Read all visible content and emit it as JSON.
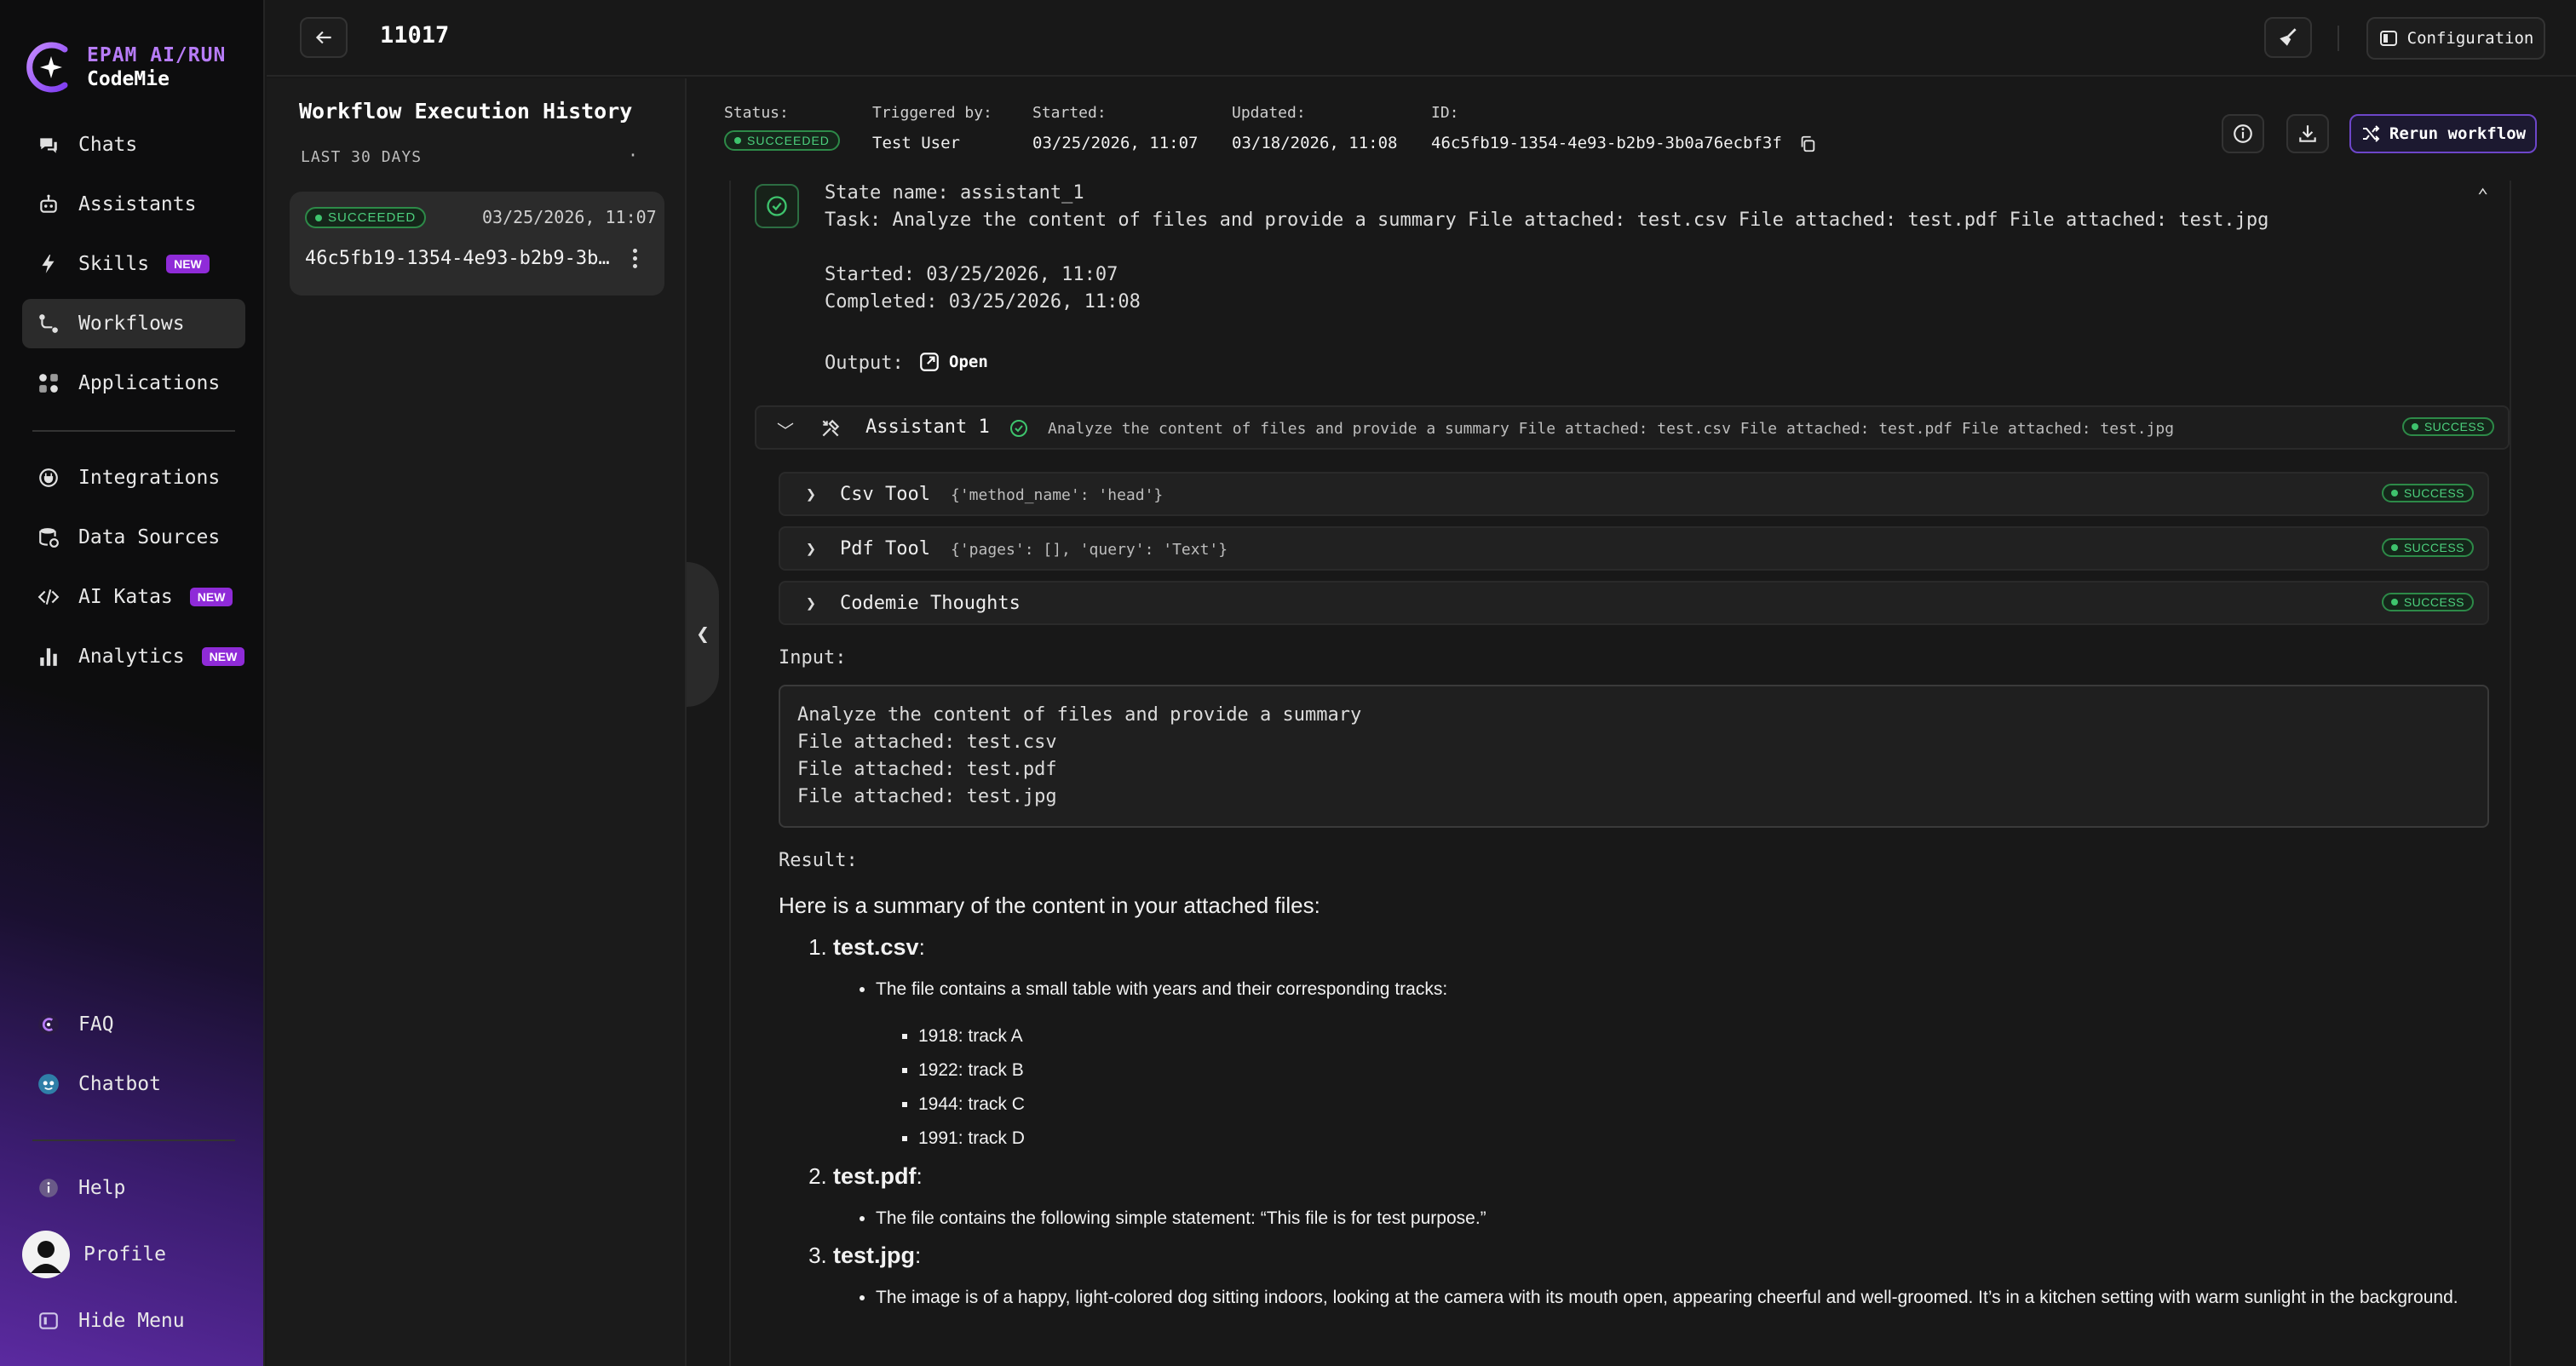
{
  "nav": {
    "brand_line1": "EPAM AI/RUN",
    "brand_line2": "CodeMie",
    "items": [
      {
        "label": "Chats",
        "icon": "chats-icon"
      },
      {
        "label": "Assistants",
        "icon": "robot-icon"
      },
      {
        "label": "Skills",
        "icon": "bolt-icon",
        "badge": "NEW"
      },
      {
        "label": "Workflows",
        "icon": "workflow-icon",
        "active": true
      },
      {
        "label": "Applications",
        "icon": "apps-icon"
      },
      {
        "label": "Integrations",
        "icon": "plug-icon"
      },
      {
        "label": "Data Sources",
        "icon": "database-icon"
      },
      {
        "label": "AI Katas",
        "icon": "code-icon",
        "badge": "NEW"
      },
      {
        "label": "Analytics",
        "icon": "bar-chart-icon",
        "badge": "NEW"
      }
    ],
    "bottom": {
      "faq": "FAQ",
      "chatbot": "Chatbot",
      "help": "Help",
      "profile": "Profile",
      "hide_menu": "Hide Menu"
    }
  },
  "topbar": {
    "title": "11017",
    "configuration": "Configuration"
  },
  "history": {
    "title": "Workflow Execution History",
    "subtitle": "LAST 30 DAYS",
    "dot": "·",
    "card": {
      "status": "SUCCEEDED",
      "date": "03/25/2026, 11:07",
      "id": "46c5fb19-1354-4e93-b2b9-3b0a76ecbf3f"
    }
  },
  "meta": {
    "status_label": "Status:",
    "status": "SUCCEEDED",
    "triggered_label": "Triggered by:",
    "triggered": "Test User",
    "started_label": "Started:",
    "started": "03/25/2026, 11:07",
    "updated_label": "Updated:",
    "updated": "03/18/2026, 11:08",
    "id_label": "ID:",
    "id": "46c5fb19-1354-4e93-b2b9-3b0a76ecbf3f",
    "rerun": "Rerun workflow"
  },
  "state": {
    "name_line": "State name: assistant_1",
    "task_line": "Task: Analyze the content of files and provide a summary File attached: test.csv File attached: test.pdf File attached: test.jpg",
    "started_line": "Started: 03/25/2026, 11:07",
    "completed_line": "Completed: 03/25/2026, 11:08",
    "output_label": "Output:",
    "open": "Open"
  },
  "assistant": {
    "name": "Assistant 1",
    "task": "Analyze the content of files and provide a summary File attached: test.csv File attached: test.pdf File attached: test.jpg",
    "status": "SUCCESS",
    "tools": [
      {
        "name": "Csv Tool",
        "args": "{'method_name': 'head'}",
        "status": "SUCCESS"
      },
      {
        "name": "Pdf Tool",
        "args": "{'pages': [], 'query': 'Text'}",
        "status": "SUCCESS"
      },
      {
        "name": "Codemie Thoughts",
        "args": "",
        "status": "SUCCESS"
      }
    ]
  },
  "input": {
    "label": "Input:",
    "lines": [
      "Analyze the content of files and provide a summary",
      "File attached: test.csv",
      "File attached: test.pdf",
      "File attached: test.jpg"
    ]
  },
  "result": {
    "label": "Result:",
    "intro": "Here is a summary of the content in your attached files:",
    "csv_name": "test.csv",
    "csv_desc": "The file contains a small table with years and their corresponding tracks:",
    "tracks": [
      "1918: track A",
      "1922: track B",
      "1944: track C",
      "1991: track D"
    ],
    "pdf_name": "test.pdf",
    "pdf_desc": "The file contains the following simple statement: “This file is for test purpose.”",
    "jpg_name": "test.jpg",
    "jpg_desc": "The image is of a happy, light-colored dog sitting indoors, looking at the camera with its mouth open, appearing cheerful and well-groomed. It’s in a kitchen setting with warm sunlight in the background."
  }
}
